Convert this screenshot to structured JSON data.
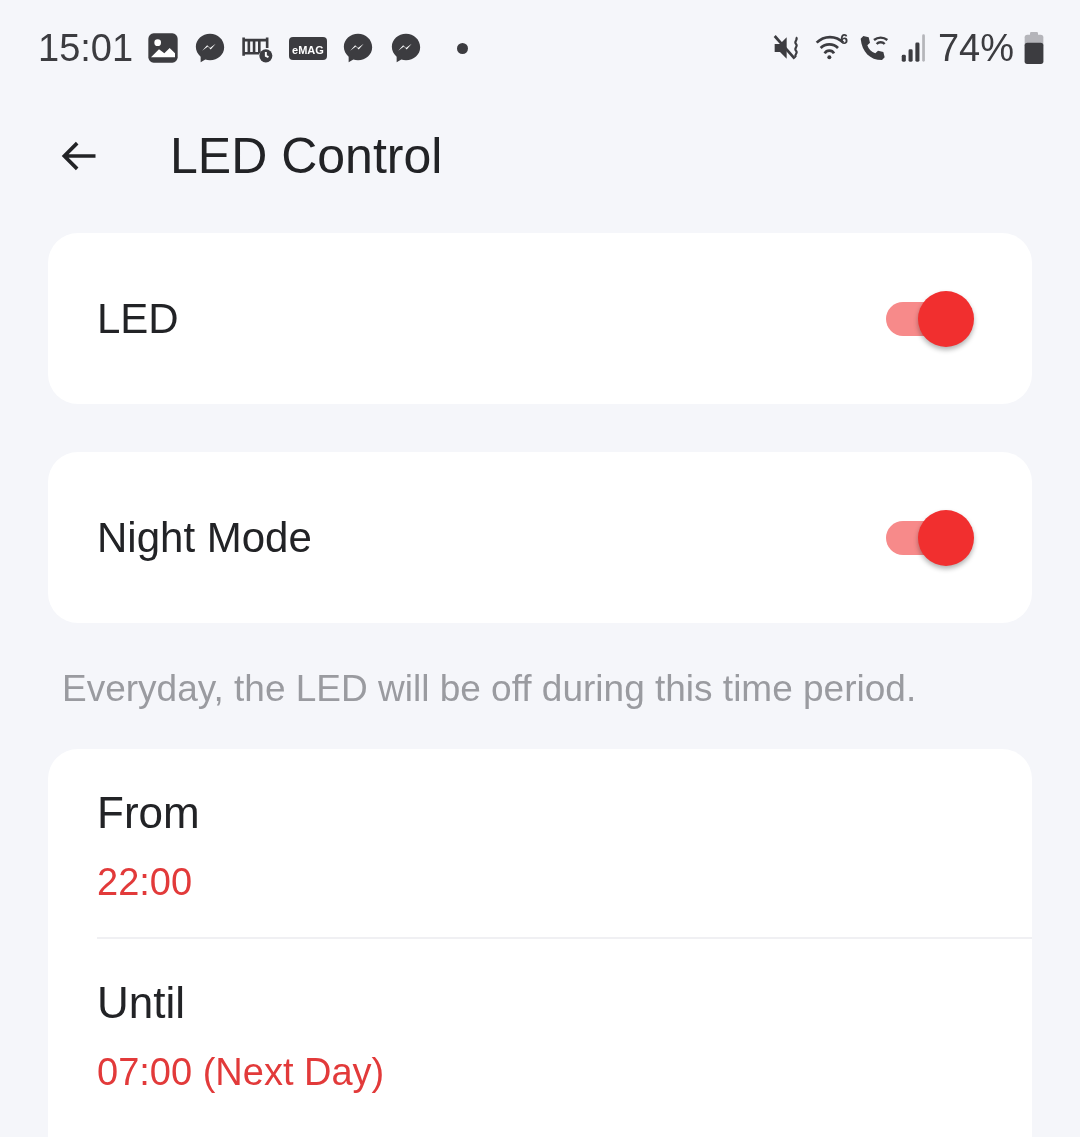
{
  "status_bar": {
    "time": "15:01",
    "shop_icon_label": "eMAG",
    "wifi_badge": "6",
    "battery": "74%"
  },
  "header": {
    "title": "LED Control"
  },
  "toggles": [
    {
      "label": "LED",
      "on": true
    },
    {
      "label": "Night Mode",
      "on": true
    }
  ],
  "hint": "Everyday, the LED will be off during this time period.",
  "schedule": [
    {
      "label": "From",
      "value": "22:00"
    },
    {
      "label": "Until",
      "value": "07:00 (Next Day)"
    }
  ]
}
